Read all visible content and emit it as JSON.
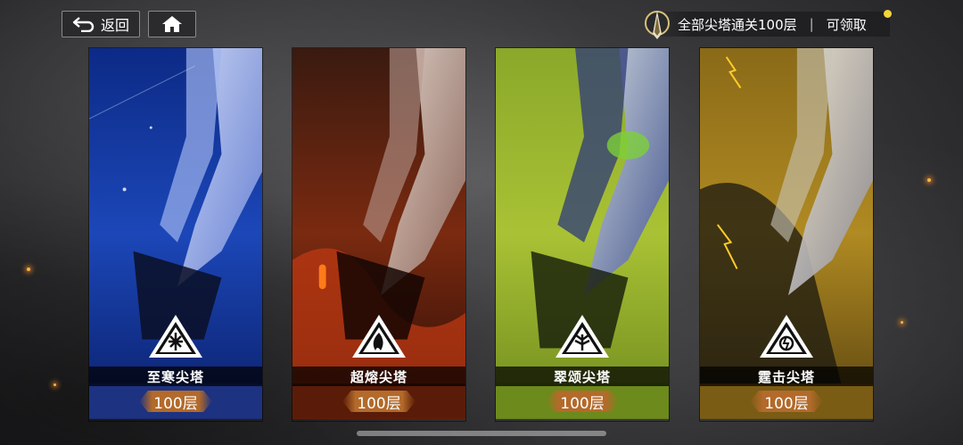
{
  "topbar": {
    "back_label": "返回",
    "home_icon": "home-icon",
    "reward_text": "全部尖塔通关100层",
    "reward_separator": "|",
    "reward_action": "可领取"
  },
  "cards": [
    {
      "title": "至寒尖塔",
      "floors": "100层",
      "theme": "ice",
      "color": "#1d3f9a"
    },
    {
      "title": "超熔尖塔",
      "floors": "100层",
      "theme": "fire",
      "color": "#c0441a"
    },
    {
      "title": "翠颂尖塔",
      "floors": "100层",
      "theme": "nature",
      "color": "#9ab52a"
    },
    {
      "title": "霆击尖塔",
      "floors": "100层",
      "theme": "thunder",
      "color": "#a07c1c"
    }
  ]
}
